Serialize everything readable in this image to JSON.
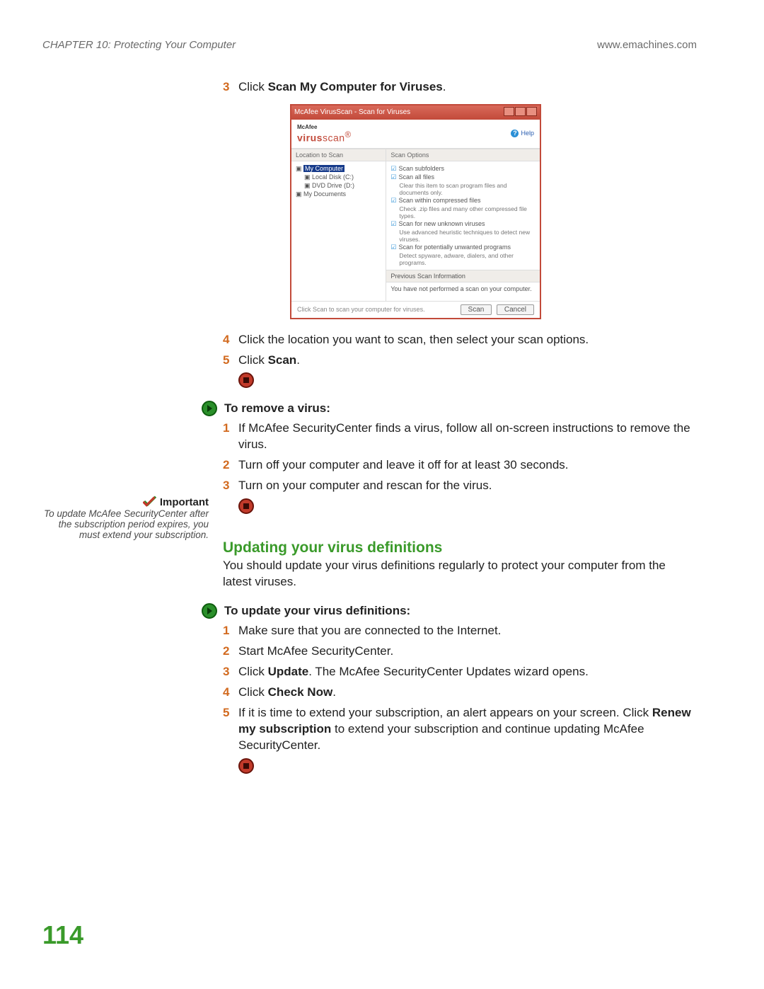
{
  "header": {
    "chapter": "CHAPTER 10: Protecting Your Computer",
    "url": "www.emachines.com"
  },
  "steps_top": {
    "s3": {
      "num": "3",
      "pre": "Click ",
      "bold": "Scan My Computer for Viruses",
      "post": "."
    },
    "s4": {
      "num": "4",
      "text": "Click the location you want to scan, then select your scan options."
    },
    "s5": {
      "num": "5",
      "pre": "Click ",
      "bold": "Scan",
      "post": "."
    }
  },
  "screenshot": {
    "title": "McAfee VirusScan - Scan for Viruses",
    "brand_small": "McAfee",
    "brand_main_bold": "virus",
    "brand_main_rest": "scan",
    "help": "Help",
    "left_head": "Location to Scan",
    "right_head": "Scan Options",
    "tree": {
      "n0": "My Computer",
      "n1": "Local Disk (C:)",
      "n2": "DVD Drive (D:)",
      "n3": "My Documents"
    },
    "opts": {
      "o1": "Scan subfolders",
      "o2": "Scan all files",
      "o2s": "Clear this item to scan program files and documents only.",
      "o3": "Scan within compressed files",
      "o3s": "Check .zip files and many other compressed file types.",
      "o4": "Scan for new unknown viruses",
      "o4s": "Use advanced heuristic techniques to detect new viruses.",
      "o5": "Scan for potentially unwanted programs",
      "o5s": "Detect spyware, adware, dialers, and other programs."
    },
    "prev_head": "Previous Scan Information",
    "prev_body": "You have not performed a scan on your computer.",
    "footer_hint": "Click Scan to scan your computer for viruses.",
    "btn_scan": "Scan",
    "btn_cancel": "Cancel"
  },
  "remove": {
    "title": "To remove a virus:",
    "s1": {
      "num": "1",
      "text": "If McAfee SecurityCenter finds a virus, follow all on-screen instructions to remove the virus."
    },
    "s2": {
      "num": "2",
      "text": "Turn off your computer and leave it off for at least 30 seconds."
    },
    "s3": {
      "num": "3",
      "text": "Turn on your computer and rescan for the virus."
    }
  },
  "section2": {
    "title": "Updating your virus definitions",
    "para": "You should update your virus definitions regularly to protect your computer from the latest viruses."
  },
  "sidebar": {
    "label": "Important",
    "text": "To update McAfee SecurityCenter after the subscription period expires, you must extend your subscription."
  },
  "update": {
    "title": "To update your virus definitions:",
    "s1": {
      "num": "1",
      "text": "Make sure that you are connected to the Internet."
    },
    "s2": {
      "num": "2",
      "text": "Start McAfee SecurityCenter."
    },
    "s3": {
      "num": "3",
      "pre": "Click ",
      "bold": "Update",
      "post": ". The McAfee SecurityCenter Updates wizard opens."
    },
    "s4": {
      "num": "4",
      "pre": "Click ",
      "bold": "Check Now",
      "post": "."
    },
    "s5": {
      "num": "5",
      "pre": "If it is time to extend your subscription, an alert appears on your screen. Click ",
      "bold": "Renew my subscription",
      "post": " to extend your subscription and continue updating McAfee SecurityCenter."
    }
  },
  "page_number": "114"
}
